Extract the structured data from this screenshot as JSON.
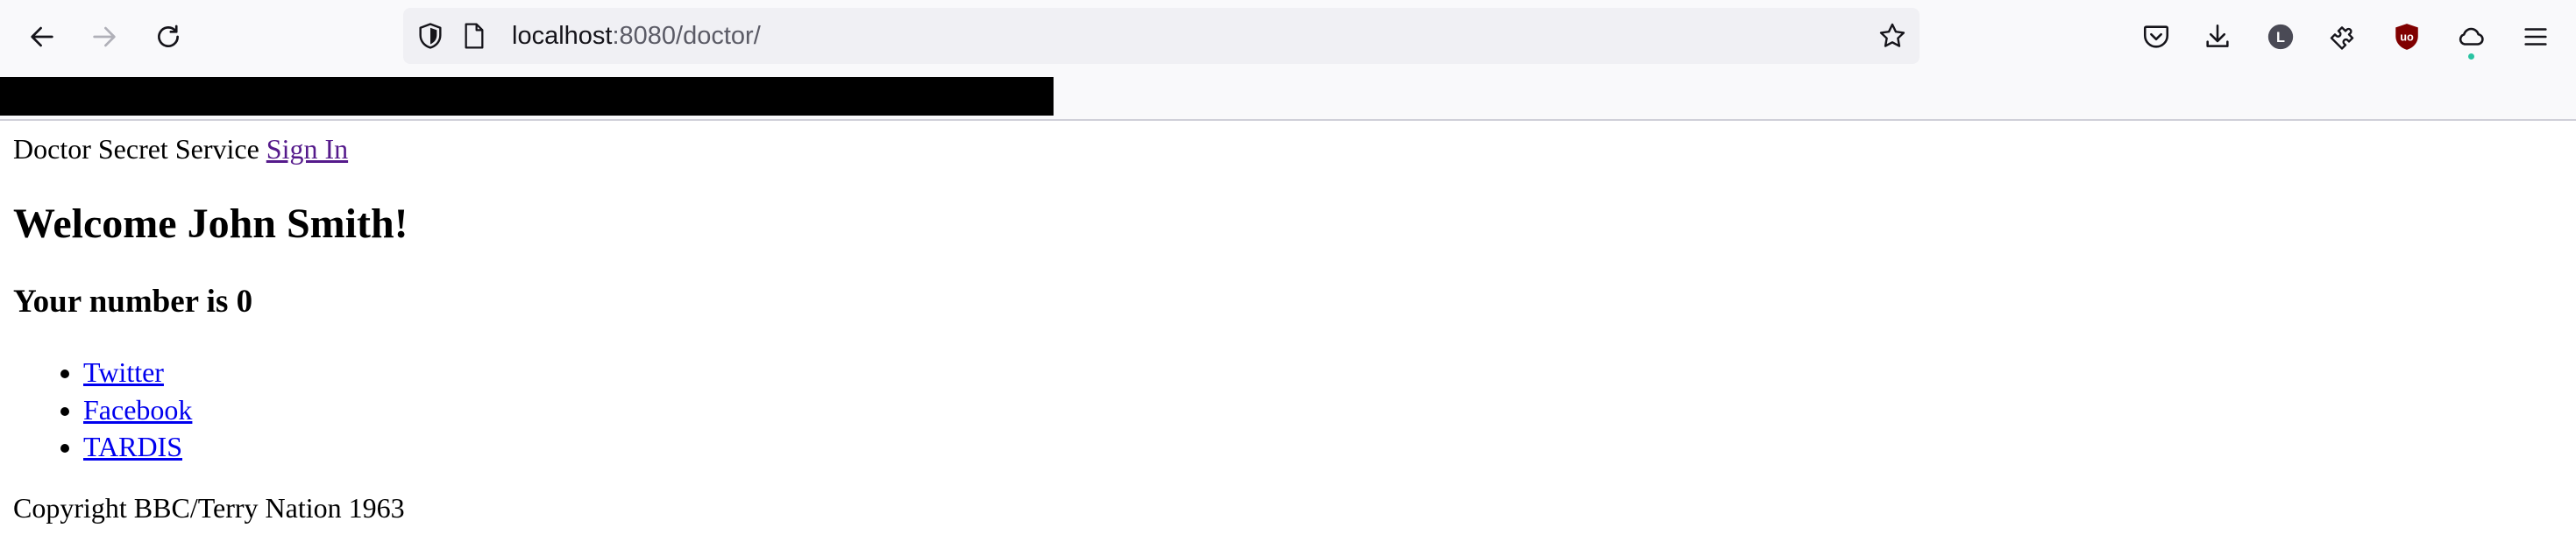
{
  "browser": {
    "url_host": "localhost",
    "url_rest": ":8080/doctor/",
    "account_initial": "L",
    "ublock_text": "uo",
    "accent_color": "#2ac3a2"
  },
  "page": {
    "site_name": "Doctor Secret Service",
    "sign_in_link": "Sign In",
    "welcome_heading": "Welcome John Smith!",
    "number_heading": "Your number is 0",
    "links": [
      {
        "label": "Twitter"
      },
      {
        "label": "Facebook"
      },
      {
        "label": "TARDIS"
      }
    ],
    "copyright": "Copyright BBC/Terry Nation 1963"
  }
}
